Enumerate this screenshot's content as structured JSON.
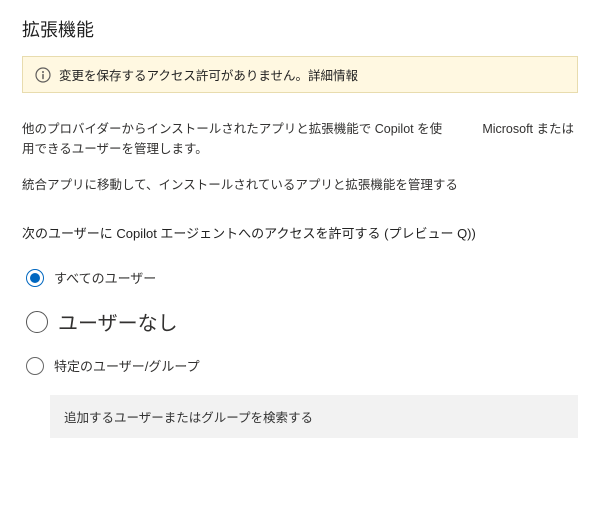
{
  "title": "拡張機能",
  "warning": {
    "text": "変更を保存するアクセス許可がありません。詳細情報"
  },
  "description": {
    "main": "他のプロバイダーからインストールされたアプリと拡張機能で Copilot を使用できるユーザーを管理します。",
    "side": "Microsoft または"
  },
  "manage_link": "統合アプリに移動して、インストールされているアプリと拡張機能を管理する",
  "access_heading": "次のユーザーに Copilot エージェントへのアクセスを許可する (プレビュー Q))",
  "options": {
    "all": "すべてのユーザー",
    "none": "ユーザーなし",
    "specific": "特定のユーザー/グループ"
  },
  "search_placeholder": "追加するユーザーまたはグループを検索する"
}
